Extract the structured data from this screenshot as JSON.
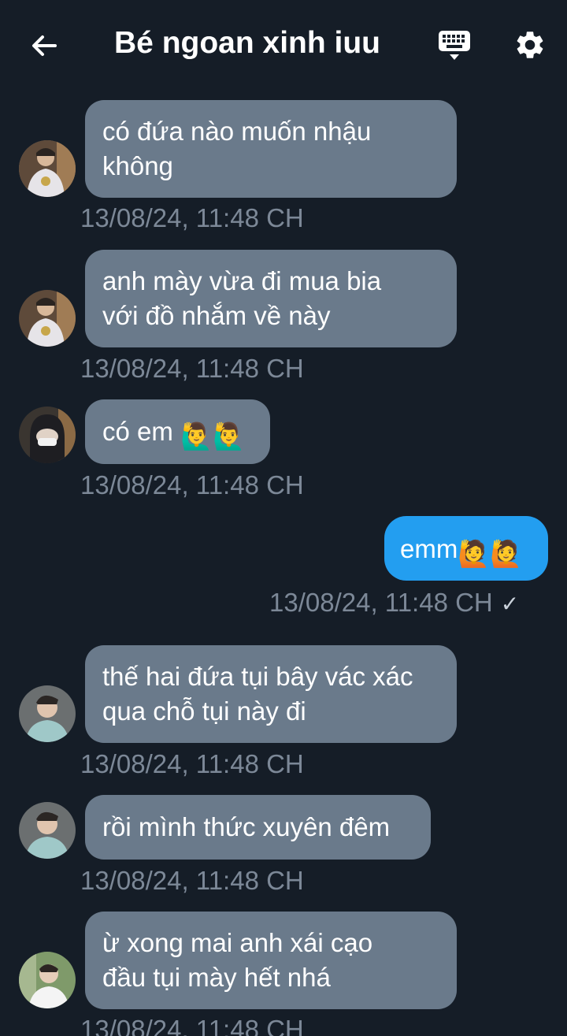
{
  "header": {
    "title": "Bé ngoan xinh iuu",
    "back_icon": "arrow-left-icon",
    "keyboard_icon": "keyboard-icon",
    "settings_icon": "gear-icon"
  },
  "messages": [
    {
      "direction": "in",
      "line1": "có đứa nào muốn nhậu",
      "line2": "không",
      "time": "13/08/24, 11:48 CH",
      "avatar": "avatar-1"
    },
    {
      "direction": "in",
      "line1": "anh mày vừa đi mua bia",
      "line2": "với đồ nhắm về này",
      "time": "13/08/24, 11:48 CH",
      "avatar": "avatar-1"
    },
    {
      "direction": "in",
      "text": "có em",
      "emoji": "🙋‍♂️🙋‍♂️",
      "time": "13/08/24, 11:48 CH",
      "avatar": "avatar-2"
    },
    {
      "direction": "out",
      "text": "emm",
      "emoji": "🙋🙋",
      "time": "13/08/24, 11:48 CH",
      "status": "✓"
    },
    {
      "direction": "in",
      "line1": "thế hai đứa tụi bây vác xác",
      "line2": "qua chỗ tụi này đi",
      "time": "13/08/24, 11:48 CH",
      "avatar": "avatar-3"
    },
    {
      "direction": "in",
      "text": "rồi mình thức xuyên đêm",
      "time": "13/08/24, 11:48 CH",
      "avatar": "avatar-3"
    },
    {
      "direction": "in",
      "line1": "ừ xong mai anh xái cạo",
      "line2": "đầu tụi mày hết nhá",
      "time": "13/08/24, 11:48 CH",
      "avatar": "avatar-4"
    }
  ],
  "colors": {
    "background": "#151d27",
    "incoming_bubble": "#6a7a8b",
    "outgoing_bubble": "#239ef0",
    "timestamp": "#7c8897"
  }
}
